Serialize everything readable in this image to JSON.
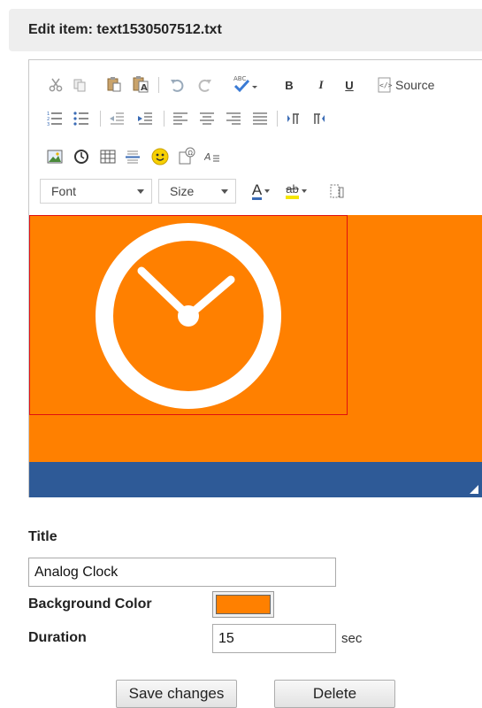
{
  "header": {
    "title": "Edit item: text1530507512.txt"
  },
  "toolbar": {
    "source_label": "Source",
    "bold_label": "B",
    "italic_label": "I",
    "underline_label": "U",
    "font_combo": "Font",
    "size_combo": "Size",
    "text_color_glyph": "A",
    "bg_color_glyph": "ab",
    "icons": [
      "cut-icon",
      "copy-icon",
      "paste-icon",
      "paste-text-icon",
      "undo-icon",
      "redo-icon",
      "spellcheck-icon",
      "bold-icon",
      "italic-icon",
      "underline-icon",
      "source-icon",
      "numbered-list-icon",
      "bulleted-list-icon",
      "outdent-icon",
      "indent-icon",
      "align-left-icon",
      "align-center-icon",
      "align-right-icon",
      "justify-icon",
      "ltr-icon",
      "rtl-icon",
      "image-icon",
      "clock-icon",
      "table-icon",
      "horizontal-line-icon",
      "smiley-icon",
      "special-char-icon",
      "remove-format-icon",
      "text-color-icon",
      "bg-color-icon",
      "maximize-icon"
    ]
  },
  "content": {
    "background_color": "#ff8000",
    "image": "analog-clock-icon"
  },
  "form": {
    "title_label": "Title",
    "title_value": "Analog Clock",
    "bg_color_label": "Background Color",
    "bg_color_value": "#ff8000",
    "duration_label": "Duration",
    "duration_value": "15",
    "duration_unit": "sec",
    "save_label": "Save changes",
    "delete_label": "Delete"
  },
  "colors": {
    "statusbar": "#2e5a97",
    "selection_border": "#e01010"
  }
}
